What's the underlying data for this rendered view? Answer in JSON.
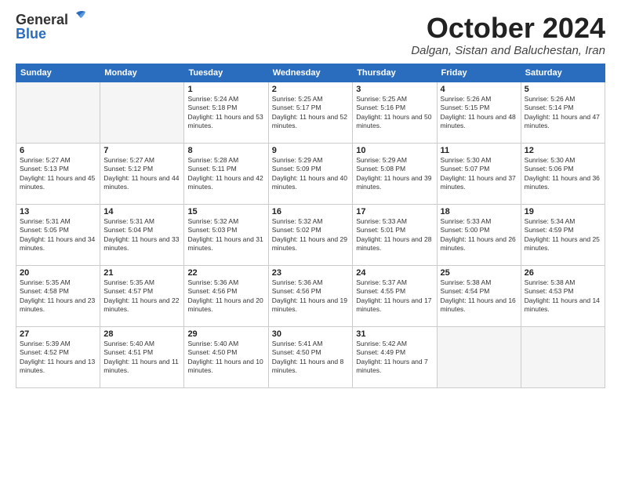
{
  "header": {
    "logo_general": "General",
    "logo_blue": "Blue",
    "month_title": "October 2024",
    "subtitle": "Dalgan, Sistan and Baluchestan, Iran"
  },
  "weekdays": [
    "Sunday",
    "Monday",
    "Tuesday",
    "Wednesday",
    "Thursday",
    "Friday",
    "Saturday"
  ],
  "weeks": [
    [
      {
        "day": "",
        "empty": true
      },
      {
        "day": "",
        "empty": true
      },
      {
        "day": "1",
        "sunrise": "5:24 AM",
        "sunset": "5:18 PM",
        "daylight": "11 hours and 53 minutes."
      },
      {
        "day": "2",
        "sunrise": "5:25 AM",
        "sunset": "5:17 PM",
        "daylight": "11 hours and 52 minutes."
      },
      {
        "day": "3",
        "sunrise": "5:25 AM",
        "sunset": "5:16 PM",
        "daylight": "11 hours and 50 minutes."
      },
      {
        "day": "4",
        "sunrise": "5:26 AM",
        "sunset": "5:15 PM",
        "daylight": "11 hours and 48 minutes."
      },
      {
        "day": "5",
        "sunrise": "5:26 AM",
        "sunset": "5:14 PM",
        "daylight": "11 hours and 47 minutes."
      }
    ],
    [
      {
        "day": "6",
        "sunrise": "5:27 AM",
        "sunset": "5:13 PM",
        "daylight": "11 hours and 45 minutes."
      },
      {
        "day": "7",
        "sunrise": "5:27 AM",
        "sunset": "5:12 PM",
        "daylight": "11 hours and 44 minutes."
      },
      {
        "day": "8",
        "sunrise": "5:28 AM",
        "sunset": "5:11 PM",
        "daylight": "11 hours and 42 minutes."
      },
      {
        "day": "9",
        "sunrise": "5:29 AM",
        "sunset": "5:09 PM",
        "daylight": "11 hours and 40 minutes."
      },
      {
        "day": "10",
        "sunrise": "5:29 AM",
        "sunset": "5:08 PM",
        "daylight": "11 hours and 39 minutes."
      },
      {
        "day": "11",
        "sunrise": "5:30 AM",
        "sunset": "5:07 PM",
        "daylight": "11 hours and 37 minutes."
      },
      {
        "day": "12",
        "sunrise": "5:30 AM",
        "sunset": "5:06 PM",
        "daylight": "11 hours and 36 minutes."
      }
    ],
    [
      {
        "day": "13",
        "sunrise": "5:31 AM",
        "sunset": "5:05 PM",
        "daylight": "11 hours and 34 minutes."
      },
      {
        "day": "14",
        "sunrise": "5:31 AM",
        "sunset": "5:04 PM",
        "daylight": "11 hours and 33 minutes."
      },
      {
        "day": "15",
        "sunrise": "5:32 AM",
        "sunset": "5:03 PM",
        "daylight": "11 hours and 31 minutes."
      },
      {
        "day": "16",
        "sunrise": "5:32 AM",
        "sunset": "5:02 PM",
        "daylight": "11 hours and 29 minutes."
      },
      {
        "day": "17",
        "sunrise": "5:33 AM",
        "sunset": "5:01 PM",
        "daylight": "11 hours and 28 minutes."
      },
      {
        "day": "18",
        "sunrise": "5:33 AM",
        "sunset": "5:00 PM",
        "daylight": "11 hours and 26 minutes."
      },
      {
        "day": "19",
        "sunrise": "5:34 AM",
        "sunset": "4:59 PM",
        "daylight": "11 hours and 25 minutes."
      }
    ],
    [
      {
        "day": "20",
        "sunrise": "5:35 AM",
        "sunset": "4:58 PM",
        "daylight": "11 hours and 23 minutes."
      },
      {
        "day": "21",
        "sunrise": "5:35 AM",
        "sunset": "4:57 PM",
        "daylight": "11 hours and 22 minutes."
      },
      {
        "day": "22",
        "sunrise": "5:36 AM",
        "sunset": "4:56 PM",
        "daylight": "11 hours and 20 minutes."
      },
      {
        "day": "23",
        "sunrise": "5:36 AM",
        "sunset": "4:56 PM",
        "daylight": "11 hours and 19 minutes."
      },
      {
        "day": "24",
        "sunrise": "5:37 AM",
        "sunset": "4:55 PM",
        "daylight": "11 hours and 17 minutes."
      },
      {
        "day": "25",
        "sunrise": "5:38 AM",
        "sunset": "4:54 PM",
        "daylight": "11 hours and 16 minutes."
      },
      {
        "day": "26",
        "sunrise": "5:38 AM",
        "sunset": "4:53 PM",
        "daylight": "11 hours and 14 minutes."
      }
    ],
    [
      {
        "day": "27",
        "sunrise": "5:39 AM",
        "sunset": "4:52 PM",
        "daylight": "11 hours and 13 minutes."
      },
      {
        "day": "28",
        "sunrise": "5:40 AM",
        "sunset": "4:51 PM",
        "daylight": "11 hours and 11 minutes."
      },
      {
        "day": "29",
        "sunrise": "5:40 AM",
        "sunset": "4:50 PM",
        "daylight": "11 hours and 10 minutes."
      },
      {
        "day": "30",
        "sunrise": "5:41 AM",
        "sunset": "4:50 PM",
        "daylight": "11 hours and 8 minutes."
      },
      {
        "day": "31",
        "sunrise": "5:42 AM",
        "sunset": "4:49 PM",
        "daylight": "11 hours and 7 minutes."
      },
      {
        "day": "",
        "empty": true
      },
      {
        "day": "",
        "empty": true
      }
    ]
  ]
}
